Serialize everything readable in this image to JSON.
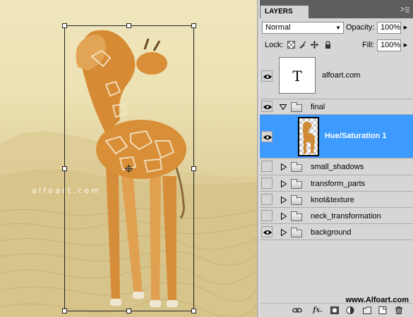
{
  "canvas": {
    "watermark": "alfoart.com"
  },
  "panel": {
    "tab_label": "LAYERS",
    "blend_mode": "Normal",
    "opacity_label": "Opacity:",
    "opacity_value": "100%",
    "lock_label": "Lock:",
    "fill_label": "Fill:",
    "fill_value": "100%"
  },
  "layers": [
    {
      "name": "alfoart.com",
      "kind": "text",
      "thumb_glyph": "T",
      "visible": true
    },
    {
      "name": "final",
      "kind": "group",
      "expanded": true,
      "visible": true
    },
    {
      "name": "Hue/Saturation 1",
      "kind": "layer",
      "selected": true,
      "visible": true
    },
    {
      "name": "small_shadows",
      "kind": "group",
      "expanded": false,
      "visible": false
    },
    {
      "name": "transform_parts",
      "kind": "group",
      "expanded": false,
      "visible": false
    },
    {
      "name": "knot&texture",
      "kind": "group",
      "expanded": false,
      "visible": false
    },
    {
      "name": "neck_transformation",
      "kind": "group",
      "expanded": false,
      "visible": false
    },
    {
      "name": "background",
      "kind": "group",
      "expanded": false,
      "visible": true
    }
  ],
  "footer": {
    "site": "www.Alfoart.com",
    "fx_label": "fx."
  },
  "colors": {
    "selection": "#3d9bff",
    "tabbar": "#5e5e5e",
    "panel_bg": "#d6d6d6"
  }
}
